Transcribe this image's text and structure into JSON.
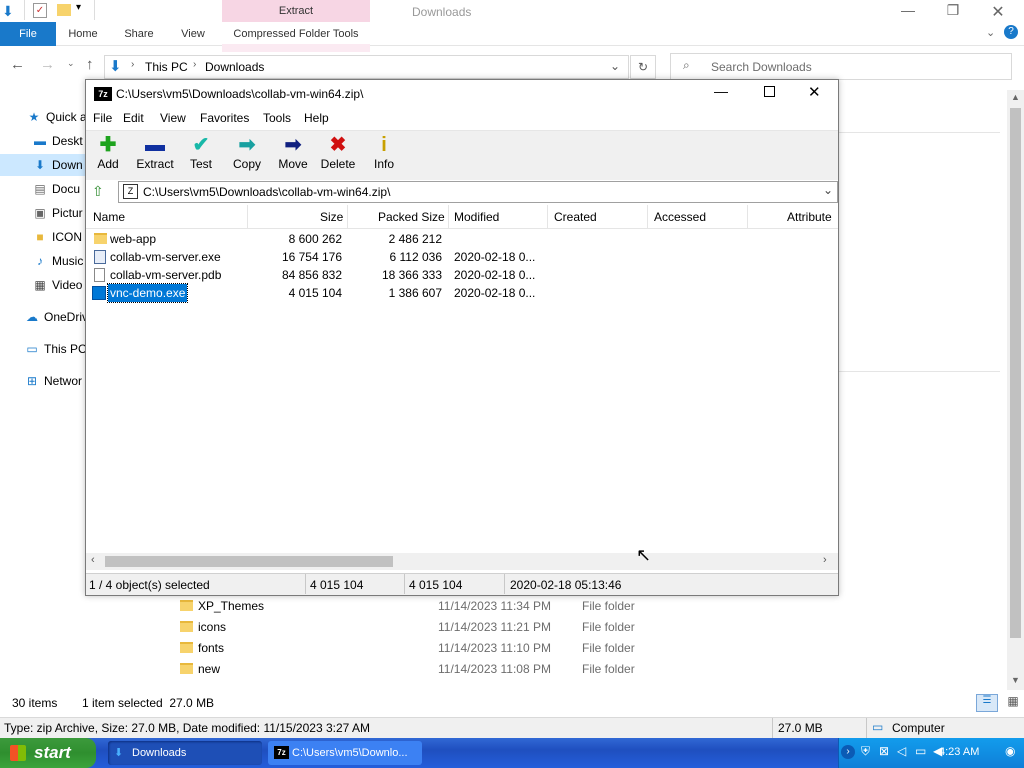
{
  "explorer": {
    "title": "Downloads",
    "ribbon_tabs": [
      "File",
      "Home",
      "Share",
      "View",
      "Compressed Folder Tools"
    ],
    "contextual_tab": "Extract",
    "breadcrumb": [
      "This PC",
      "Downloads"
    ],
    "search_placeholder": "Search Downloads",
    "nav_items": [
      "Quick a",
      "Deskt",
      "Down",
      "Docu",
      "Pictur",
      "ICON",
      "Music",
      "Video",
      "OneDriv",
      "This PC",
      "Networ"
    ],
    "files": [
      {
        "name": "XP_Themes",
        "date": "11/14/2023 11:34 PM",
        "type": "File folder"
      },
      {
        "name": "icons",
        "date": "11/14/2023 11:21 PM",
        "type": "File folder"
      },
      {
        "name": "fonts",
        "date": "11/14/2023 11:10 PM",
        "type": "File folder"
      },
      {
        "name": "new",
        "date": "11/14/2023 11:08 PM",
        "type": "File folder"
      }
    ],
    "status_items": "30 items",
    "status_selected": "1 item selected  27.0 MB",
    "detail_status": "Type: zip Archive, Size: 27.0 MB, Date modified: 11/15/2023 3:27 AM",
    "detail_size": "27.0 MB",
    "detail_location": "Computer"
  },
  "sevenzip": {
    "title": "C:\\Users\\vm5\\Downloads\\collab-vm-win64.zip\\",
    "menu": [
      "File",
      "Edit",
      "View",
      "Favorites",
      "Tools",
      "Help"
    ],
    "toolbar": [
      "Add",
      "Extract",
      "Test",
      "Copy",
      "Move",
      "Delete",
      "Info"
    ],
    "path": "C:\\Users\\vm5\\Downloads\\collab-vm-win64.zip\\",
    "columns": [
      "Name",
      "Size",
      "Packed Size",
      "Modified",
      "Created",
      "Accessed",
      "Attribute"
    ],
    "rows": [
      {
        "name": "web-app",
        "size": "8 600 262",
        "packed": "2 486 212",
        "modified": ""
      },
      {
        "name": "collab-vm-server.exe",
        "size": "16 754 176",
        "packed": "6 112 036",
        "modified": "2020-02-18 0..."
      },
      {
        "name": "collab-vm-server.pdb",
        "size": "84 856 832",
        "packed": "18 366 333",
        "modified": "2020-02-18 0..."
      },
      {
        "name": "vnc-demo.exe",
        "size": "4 015 104",
        "packed": "1 386 607",
        "modified": "2020-02-18 0..."
      }
    ],
    "status": {
      "selected": "1 / 4 object(s) selected",
      "size": "4 015 104",
      "packed": "4 015 104",
      "date": "2020-02-18 05:13:46"
    }
  },
  "taskbar": {
    "start": "start",
    "buttons": [
      "Downloads",
      "C:\\Users\\vm5\\Downlo..."
    ],
    "clock": "4:23 AM"
  },
  "colors": {
    "accent": "#1979ca",
    "selection": "#0078d7",
    "taskbar": "#245edb",
    "start": "#3c9a3c"
  }
}
